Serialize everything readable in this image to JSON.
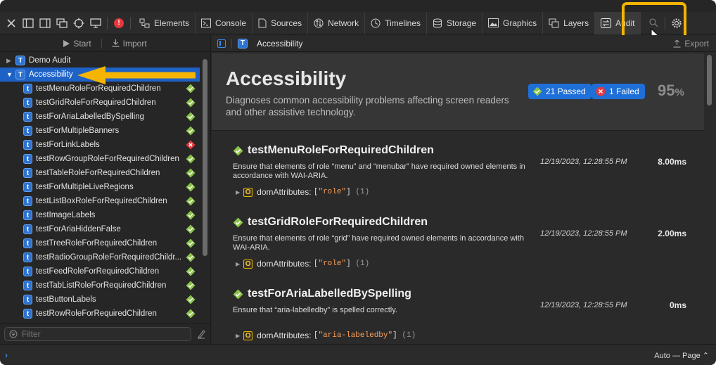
{
  "toolbar": {
    "tabs": [
      {
        "label": "Elements",
        "icon": "elements-icon"
      },
      {
        "label": "Console",
        "icon": "console-icon"
      },
      {
        "label": "Sources",
        "icon": "sources-icon"
      },
      {
        "label": "Network",
        "icon": "network-icon"
      },
      {
        "label": "Timelines",
        "icon": "timelines-icon"
      },
      {
        "label": "Storage",
        "icon": "storage-icon"
      },
      {
        "label": "Graphics",
        "icon": "graphics-icon"
      },
      {
        "label": "Layers",
        "icon": "layers-icon"
      },
      {
        "label": "Audit",
        "icon": "audit-icon",
        "selected": true
      }
    ],
    "error_badge": "!",
    "highlight_color": "#f4b400"
  },
  "sidebar": {
    "start_label": "Start",
    "import_label": "Import",
    "groups": [
      {
        "label": "Demo Audit",
        "expanded": false
      },
      {
        "label": "Accessibility",
        "expanded": true,
        "selected": true
      }
    ],
    "tests": [
      {
        "label": "testMenuRoleForRequiredChildren",
        "status": "pass"
      },
      {
        "label": "testGridRoleForRequiredChildren",
        "status": "pass"
      },
      {
        "label": "testForAriaLabelledBySpelling",
        "status": "pass"
      },
      {
        "label": "testForMultipleBanners",
        "status": "pass"
      },
      {
        "label": "testForLinkLabels",
        "status": "fail"
      },
      {
        "label": "testRowGroupRoleForRequiredChildren",
        "status": "pass"
      },
      {
        "label": "testTableRoleForRequiredChildren",
        "status": "pass"
      },
      {
        "label": "testForMultipleLiveRegions",
        "status": "pass"
      },
      {
        "label": "testListBoxRoleForRequiredChildren",
        "status": "pass"
      },
      {
        "label": "testImageLabels",
        "status": "pass"
      },
      {
        "label": "testForAriaHiddenFalse",
        "status": "pass"
      },
      {
        "label": "testTreeRoleForRequiredChildren",
        "status": "pass"
      },
      {
        "label": "testRadioGroupRoleForRequiredChildr...",
        "status": "pass"
      },
      {
        "label": "testFeedRoleForRequiredChildren",
        "status": "pass"
      },
      {
        "label": "testTabListRoleForRequiredChildren",
        "status": "pass"
      },
      {
        "label": "testButtonLabels",
        "status": "pass"
      },
      {
        "label": "testRowRoleForRequiredChildren",
        "status": "pass"
      }
    ],
    "filter_placeholder": "Filter"
  },
  "content": {
    "breadcrumb": "Accessibility",
    "export_label": "Export",
    "header": {
      "title": "Accessibility",
      "description": "Diagnoses common accessibility problems affecting screen readers and other assistive technology.",
      "passed_label": "21 Passed",
      "failed_label": "1 Failed",
      "percent": "95",
      "percent_sign": "%"
    },
    "results": [
      {
        "title": "testMenuRoleForRequiredChildren",
        "description": "Ensure that elements of role “menu” and “menubar” have required owned elements in accordance with WAI-ARIA.",
        "timestamp": "12/19/2023, 12:28:55 PM",
        "duration": "8.00ms",
        "attr_name": "domAttributes:",
        "attr_open": "[",
        "attr_value": "\"role\"",
        "attr_close": "]",
        "attr_count": "(1)"
      },
      {
        "title": "testGridRoleForRequiredChildren",
        "description": "Ensure that elements of role “grid” have required owned elements in accordance with WAI-ARIA.",
        "timestamp": "12/19/2023, 12:28:55 PM",
        "duration": "2.00ms",
        "attr_name": "domAttributes:",
        "attr_open": "[",
        "attr_value": "\"role\"",
        "attr_close": "]",
        "attr_count": "(1)"
      },
      {
        "title": "testForAriaLabelledBySpelling",
        "description": "Ensure that “aria-labelledby” is spelled correctly.",
        "timestamp": "12/19/2023, 12:28:55 PM",
        "duration": "0ms",
        "attr_name": "domAttributes:",
        "attr_open": "[",
        "attr_value": "\"aria-labeledby\"",
        "attr_close": "]",
        "attr_count": "(1)"
      }
    ]
  },
  "bottom": {
    "prompt": "›",
    "context": "Auto — Page ⌃"
  },
  "colors": {
    "selection": "#1e62c6",
    "pass": "#8bc34a",
    "fail": "#e5383b",
    "arrow": "#f4b400"
  }
}
